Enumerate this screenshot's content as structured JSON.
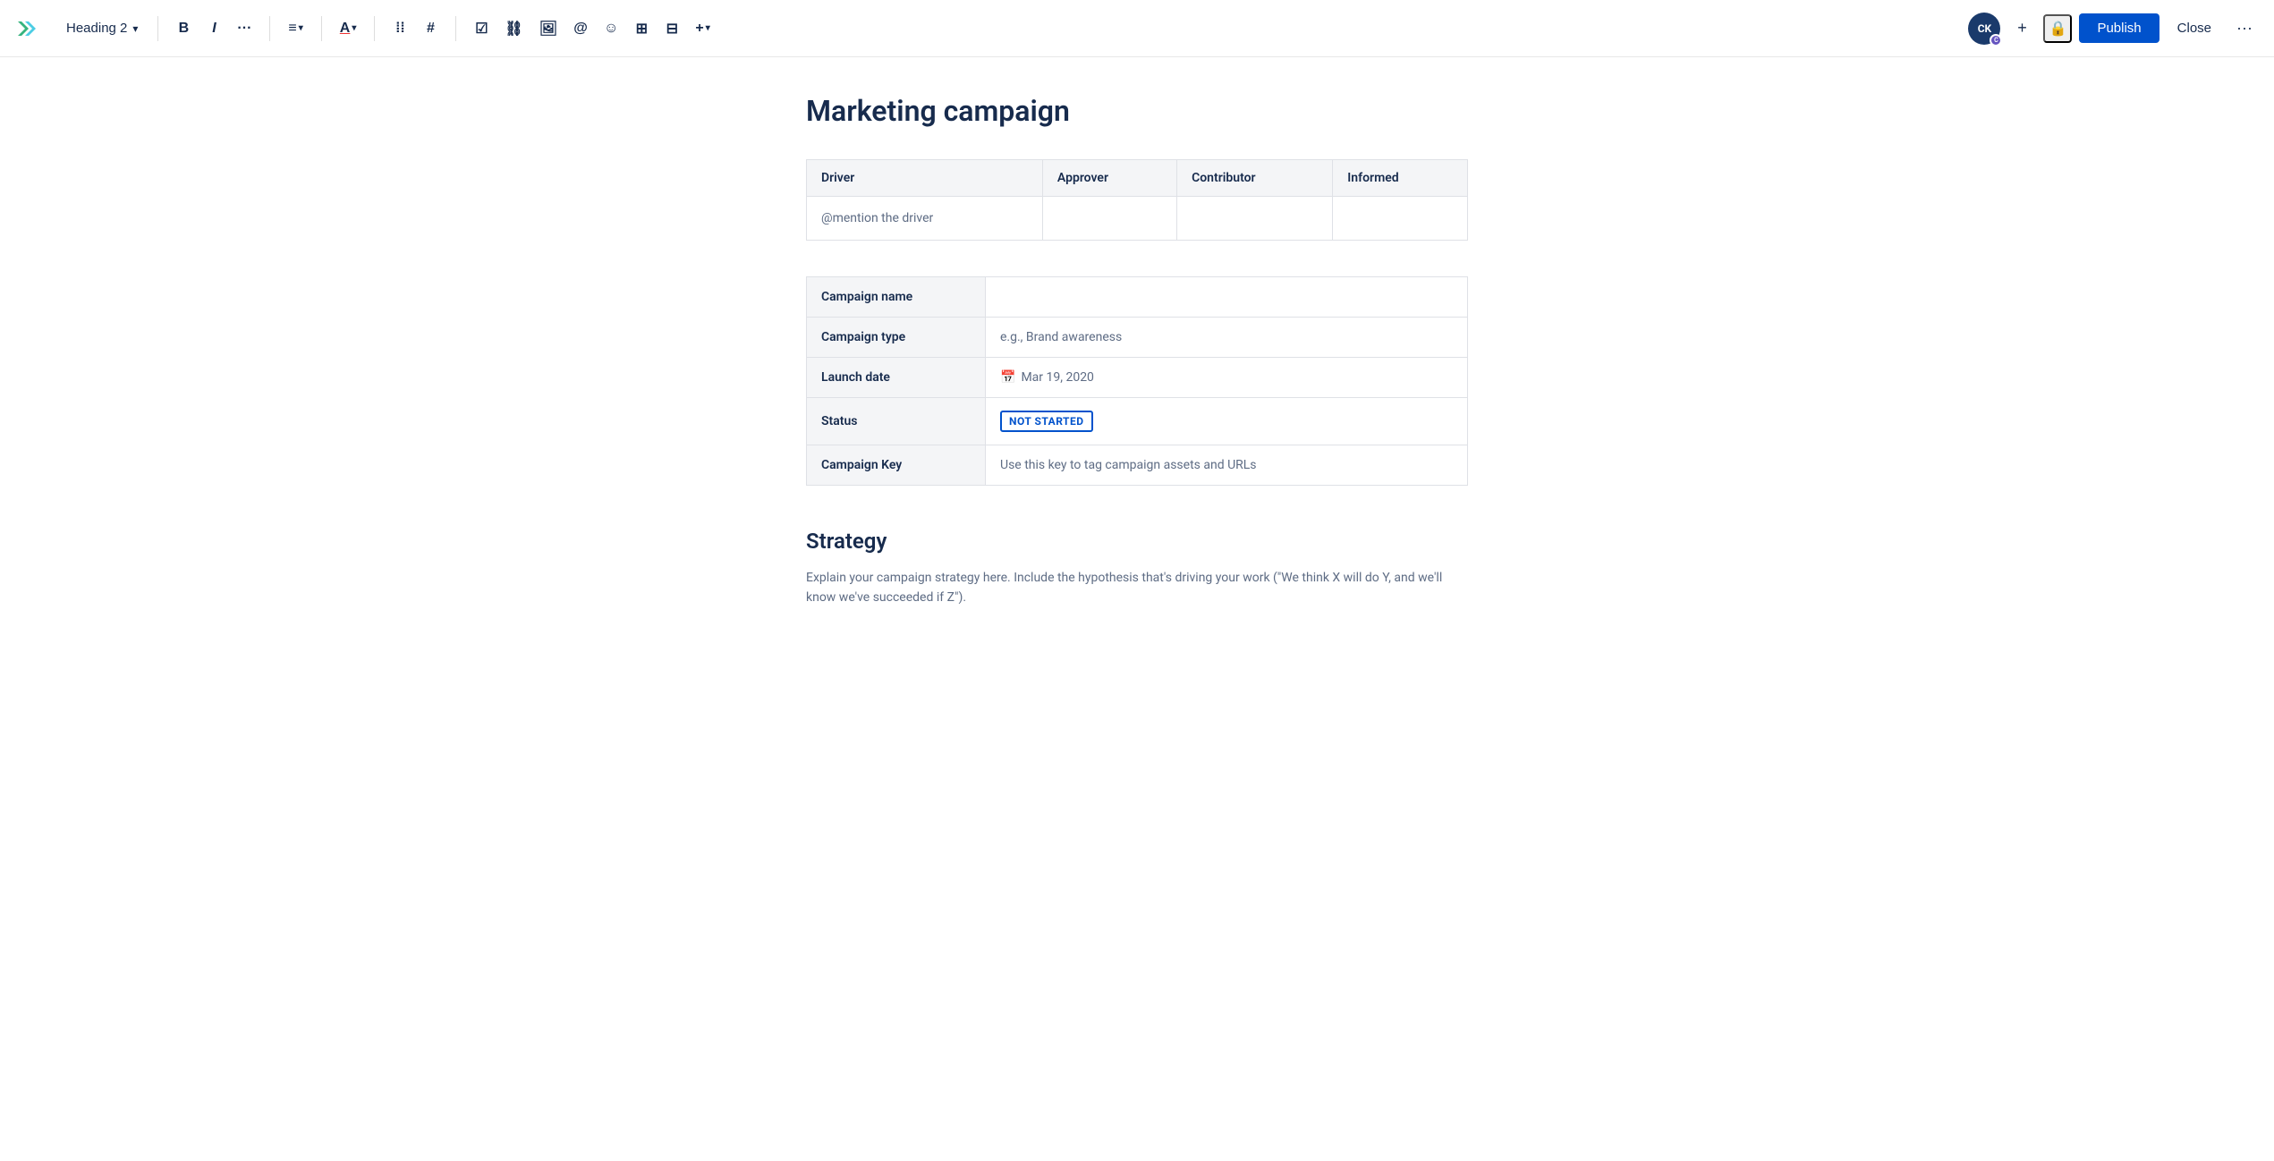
{
  "toolbar": {
    "heading_label": "Heading 2",
    "bold_label": "B",
    "italic_label": "I",
    "more_label": "···",
    "align_label": "≡",
    "color_label": "A",
    "bullet_list_label": "☰",
    "number_list_label": "⊟",
    "task_label": "☑",
    "link_label": "🔗",
    "image_label": "🖼",
    "mention_label": "@",
    "emoji_label": "☺",
    "table_label": "⊞",
    "layout_label": "⊟",
    "insert_label": "+",
    "user_initials": "CK",
    "add_label": "+",
    "publish_label": "Publish",
    "close_label": "Close",
    "more_options_label": "···"
  },
  "page": {
    "title": "Marketing campaign"
  },
  "daci_table": {
    "headers": [
      "Driver",
      "Approver",
      "Contributor",
      "Informed"
    ],
    "row": {
      "driver": "@mention the driver",
      "approver": "",
      "contributor": "",
      "informed": ""
    }
  },
  "campaign_table": {
    "rows": [
      {
        "label": "Campaign name",
        "value": ""
      },
      {
        "label": "Campaign type",
        "value": "e.g., Brand awareness"
      },
      {
        "label": "Launch date",
        "value": "Mar 19, 2020"
      },
      {
        "label": "Status",
        "value": "NOT STARTED"
      },
      {
        "label": "Campaign Key",
        "value": "Use this key to tag campaign assets and URLs"
      }
    ]
  },
  "strategy": {
    "heading": "Strategy",
    "body": "Explain your campaign strategy here. Include the hypothesis that's driving your work (\"We think X will do Y, and we'll know we've succeeded if Z\")."
  }
}
